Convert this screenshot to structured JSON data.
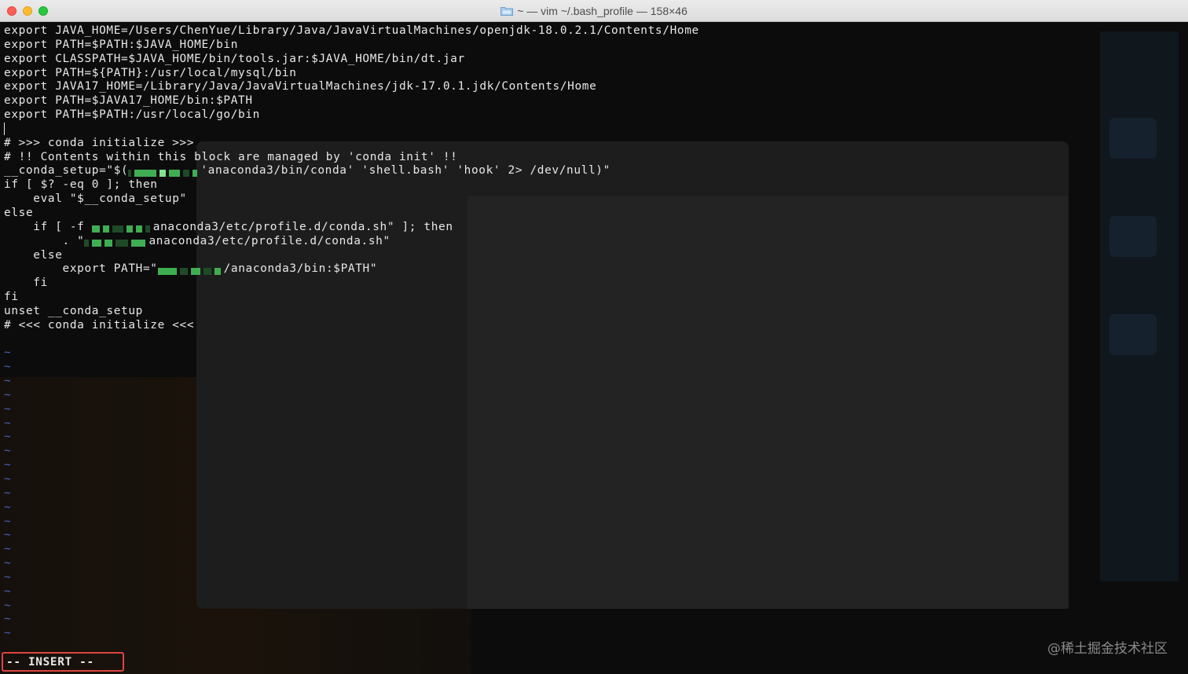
{
  "window": {
    "title": "~ — vim ~/.bash_profile — 158×46",
    "title_icon": "folder-icon"
  },
  "editor": {
    "lines": [
      "export JAVA_HOME=/Users/ChenYue/Library/Java/JavaVirtualMachines/openjdk-18.0.2.1/Contents/Home",
      "export PATH=$PATH:$JAVA_HOME/bin",
      "export CLASSPATH=$JAVA_HOME/bin/tools.jar:$JAVA_HOME/bin/dt.jar",
      "export PATH=${PATH}:/usr/local/mysql/bin",
      "export JAVA17_HOME=/Library/Java/JavaVirtualMachines/jdk-17.0.1.jdk/Contents/Home",
      "export PATH=$JAVA17_HOME/bin:$PATH",
      "export PATH=$PATH:/usr/local/go/bin",
      "",
      "# >>> conda initialize >>>",
      "# !! Contents within this block are managed by 'conda init' !!",
      [
        "__conda_setup=\"$(",
        "'anaconda3/bin/conda' 'shell.bash' 'hook' 2> /dev/null)\""
      ],
      "if [ $? -eq 0 ]; then",
      "    eval \"$__conda_setup\"",
      "else",
      [
        "    if [ -f ",
        "anaconda3/etc/profile.d/conda.sh\" ]; then"
      ],
      [
        "        . \"",
        "anaconda3/etc/profile.d/conda.sh\""
      ],
      "    else",
      [
        "        export PATH=\"",
        "/anaconda3/bin:$PATH\""
      ],
      "    fi",
      "fi",
      "unset __conda_setup",
      "# <<< conda initialize <<<",
      ""
    ],
    "empty_line_marker": "~",
    "empty_line_count": 21
  },
  "status": {
    "mode": "-- INSERT --"
  },
  "watermark": "@稀土掘金技术社区",
  "colors": {
    "text": "#e8e8e8",
    "tilde": "#4e61b8",
    "highlight_box": "#e0443e",
    "redaction": "#3fae52"
  }
}
